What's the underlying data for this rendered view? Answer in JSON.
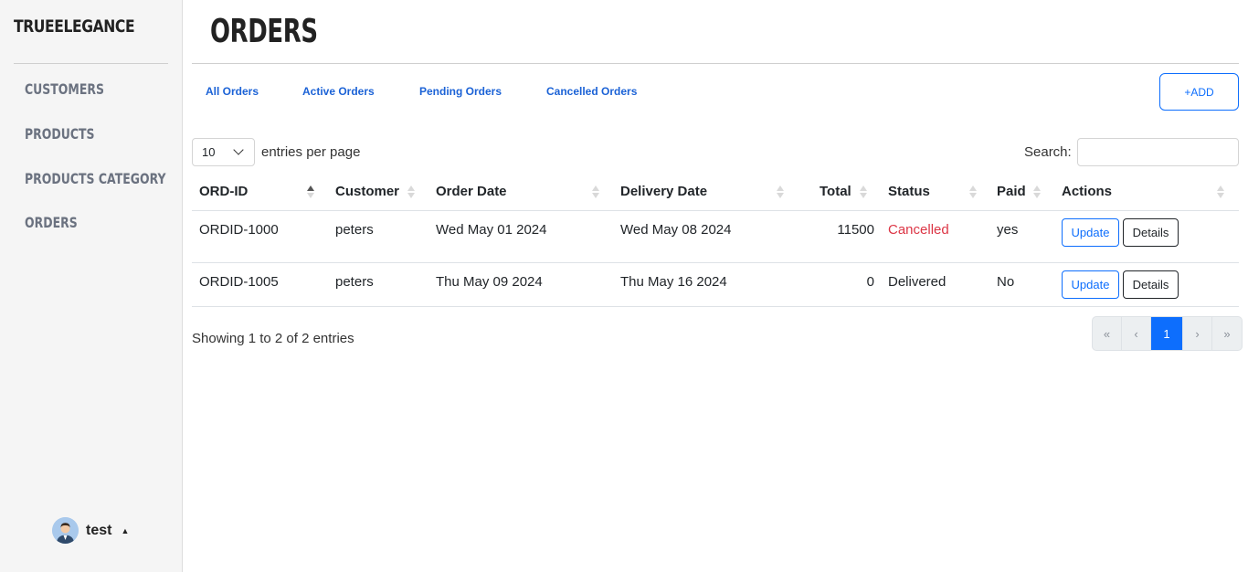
{
  "sidebar": {
    "brand": "TRUEELEGANCE",
    "items": [
      {
        "label": "CUSTOMERS"
      },
      {
        "label": "PRODUCTS"
      },
      {
        "label": "PRODUCTS CATEGORY"
      },
      {
        "label": "ORDERS"
      }
    ],
    "user": {
      "name": "test",
      "avatar_icon": "user-avatar-icon",
      "menu_icon": "caret-up-icon"
    }
  },
  "page": {
    "title": "ORDERS"
  },
  "tabs": [
    {
      "label": "All Orders"
    },
    {
      "label": "Active Orders"
    },
    {
      "label": "Pending Orders"
    },
    {
      "label": "Cancelled Orders"
    }
  ],
  "add_button": {
    "label": "+ADD"
  },
  "table_controls": {
    "page_length": "10",
    "page_length_suffix": "entries per page",
    "search_label": "Search:",
    "search_value": ""
  },
  "table": {
    "columns": [
      "ORD-ID",
      "Customer",
      "Order Date",
      "Delivery Date",
      "Total",
      "Status",
      "Paid",
      "Actions"
    ],
    "sorted_column": "ORD-ID",
    "rows": [
      {
        "ord_id": "ORDID-1000",
        "customer": "peters",
        "order_date": "Wed May 01 2024",
        "delivery_date": "Wed May 08 2024",
        "total": "11500",
        "status": "Cancelled",
        "paid": "yes",
        "update_label": "Update",
        "details_label": "Details"
      },
      {
        "ord_id": "ORDID-1005",
        "customer": "peters",
        "order_date": "Thu May 09 2024",
        "delivery_date": "Thu May 16 2024",
        "total": "0",
        "status": "Delivered",
        "paid": "No",
        "update_label": "Update",
        "details_label": "Details"
      }
    ]
  },
  "footer": {
    "info": "Showing 1 to 2 of 2 entries",
    "pagination": {
      "first": "«",
      "prev": "‹",
      "current": "1",
      "next": "›",
      "last": "»"
    }
  },
  "colors": {
    "accent": "#0d6efd",
    "link": "#1b62d6",
    "cancelled": "#dc3545",
    "sidebar_bg": "#f5f5f5"
  }
}
